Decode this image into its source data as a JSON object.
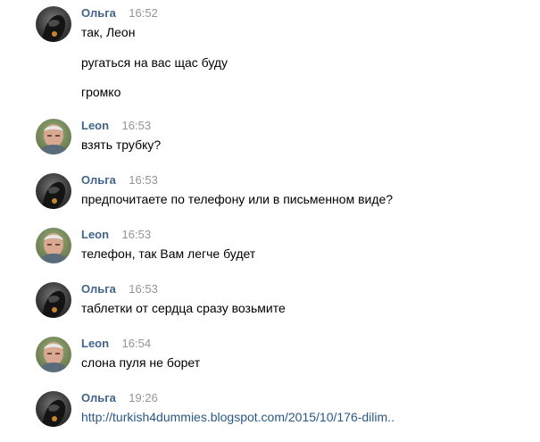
{
  "colors": {
    "author": "#42648b",
    "time": "#939393",
    "text": "#000000",
    "link": "#2a5885",
    "background": "#ffffff"
  },
  "messages": [
    {
      "author": "Ольга",
      "avatar": "olga-avatar-icon",
      "time": "16:52",
      "lines": [
        "так, Леон",
        "ругаться на вас щас буду",
        "громко"
      ]
    },
    {
      "author": "Leon",
      "avatar": "leon-avatar-icon",
      "time": "16:53",
      "lines": [
        "взять трубку?"
      ]
    },
    {
      "author": "Ольга",
      "avatar": "olga-avatar-icon",
      "time": "16:53",
      "lines": [
        "предпочитаете по телефону или в письменном виде?"
      ]
    },
    {
      "author": "Leon",
      "avatar": "leon-avatar-icon",
      "time": "16:53",
      "lines": [
        "телефон, так Вам легче будет"
      ]
    },
    {
      "author": "Ольга",
      "avatar": "olga-avatar-icon",
      "time": "16:53",
      "lines": [
        "таблетки от сердца сразу возьмите"
      ]
    },
    {
      "author": "Leon",
      "avatar": "leon-avatar-icon",
      "time": "16:54",
      "lines": [
        "слона пуля не борет"
      ]
    },
    {
      "author": "Ольга",
      "avatar": "olga-avatar-icon",
      "time": "19:26",
      "link": "http://turkish4dummies.blogspot.com/2015/10/176-dilim.."
    }
  ]
}
